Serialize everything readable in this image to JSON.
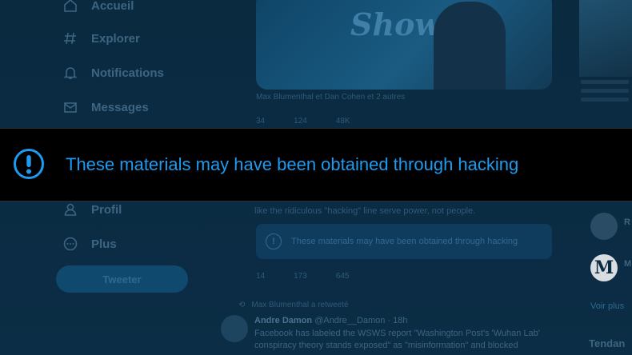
{
  "nav": {
    "items": [
      {
        "label": "Accueil",
        "icon": "home-icon"
      },
      {
        "label": "Explorer",
        "icon": "hashtag-icon"
      },
      {
        "label": "Notifications",
        "icon": "bell-icon"
      },
      {
        "label": "Messages",
        "icon": "mail-icon"
      },
      {
        "label": "Profil",
        "icon": "user-icon"
      },
      {
        "label": "Plus",
        "icon": "more-icon"
      }
    ],
    "tweet_button": "Tweeter"
  },
  "media": {
    "overlay_text": "Show",
    "caption": "Max Blumenthal et Dan Cohen et 2 autres"
  },
  "actions1": [
    "34",
    "124",
    "48K"
  ],
  "quote_text": "like the ridiculous \"hacking\" line serve power, not people.",
  "small_warning": "These materials may have been obtained through hacking",
  "actions2": [
    "14",
    "173",
    "645"
  ],
  "retweet_label": "Max Blumenthal a retweeté",
  "tweet": {
    "name": "Andre Damon",
    "handle": "@Andre__Damon · 18h",
    "text": "Facebook has labeled the WSWS report \"Washington Post's 'Wuhan Lab' conspiracy theory stands exposed\" as \"misinformation\" and blocked"
  },
  "right": {
    "show_more": "Voir plus",
    "trends": "Tendan",
    "letters": [
      "R",
      "M"
    ]
  },
  "banner": {
    "text": "These materials may have been obtained through hacking",
    "icon": "exclamation-icon"
  },
  "colors": {
    "accent": "#1d9bf0",
    "banner_bg": "#000000"
  }
}
